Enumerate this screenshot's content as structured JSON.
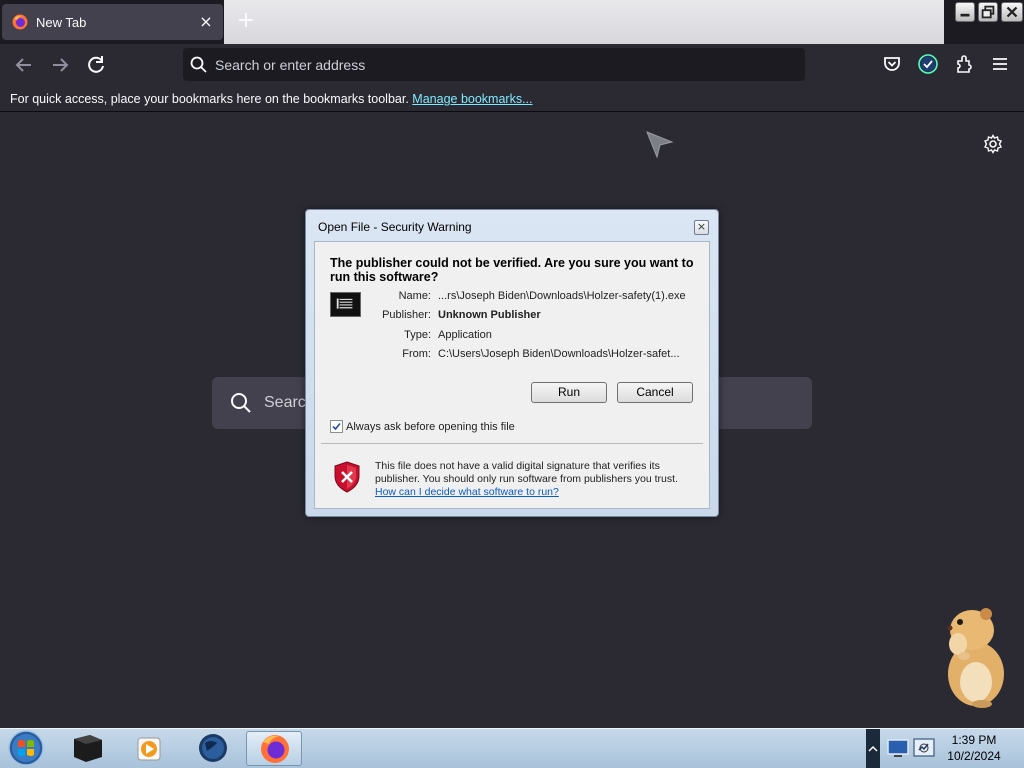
{
  "browser": {
    "tab": {
      "title": "New Tab",
      "close_glyph": "×"
    },
    "new_tab_glyph": "+",
    "urlbar": {
      "placeholder": "Search or enter address"
    },
    "bookmarks": {
      "text": "For quick access, place your bookmarks here on the bookmarks toolbar.",
      "link": "Manage bookmarks..."
    },
    "page_search": {
      "placeholder": "Search"
    }
  },
  "dialog": {
    "title": "Open File - Security Warning",
    "close_glyph": "×",
    "heading": "The publisher could not be verified.  Are you sure you want to run this software?",
    "fields": {
      "name_label": "Name:",
      "name_value": "...rs\\Joseph Biden\\Downloads\\Holzer-safety(1).exe",
      "publisher_label": "Publisher:",
      "publisher_value": "Unknown Publisher",
      "type_label": "Type:",
      "type_value": "Application",
      "from_label": "From:",
      "from_value": "C:\\Users\\Joseph Biden\\Downloads\\Holzer-safet..."
    },
    "run_label": "Run",
    "cancel_label": "Cancel",
    "checkbox_label": "Always ask before opening this file",
    "checkbox_checked": true,
    "warning_text": "This file does not have a valid digital signature that verifies its publisher.  You should only run software from publishers you trust.",
    "warning_link": "How can I decide what software to run?"
  },
  "taskbar": {
    "time": "1:39 PM",
    "date": "10/2/2024"
  },
  "colors": {
    "page_bg": "#2b2a33",
    "link": "#80ebff",
    "accent_check": "#54ffbd"
  }
}
